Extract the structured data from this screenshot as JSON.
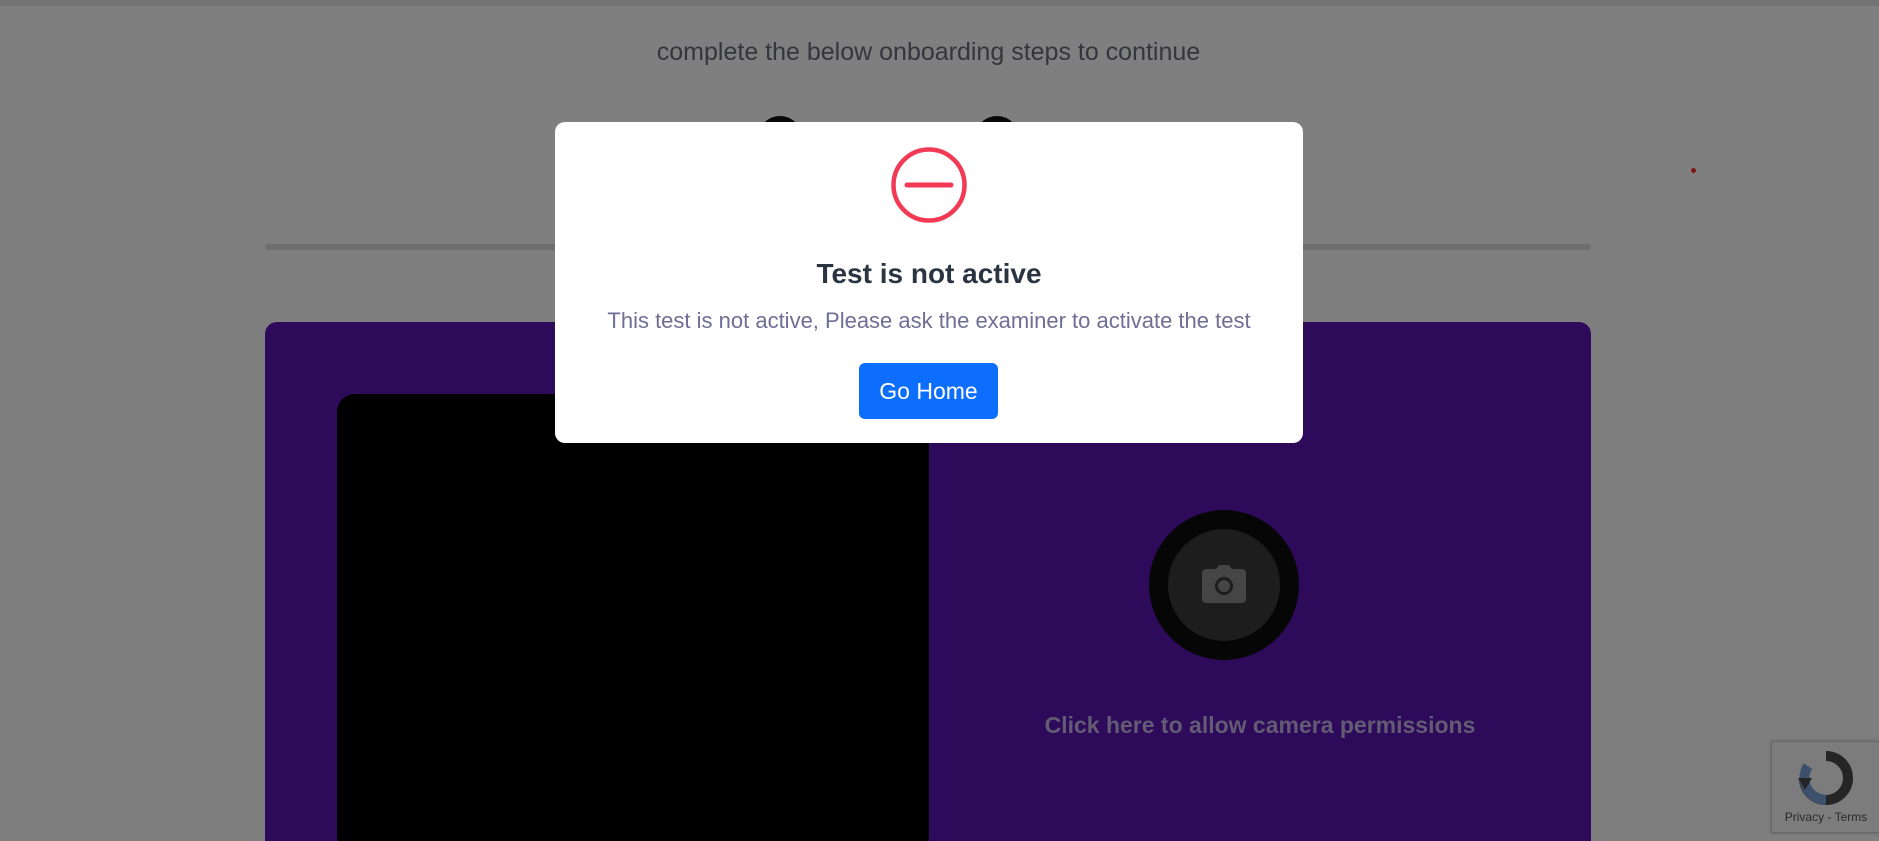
{
  "page": {
    "subtitle": "complete the below onboarding steps to continue"
  },
  "camera": {
    "icon": "camera-icon",
    "prompt": "Click here to allow camera permissions"
  },
  "modal": {
    "icon": "minus-circle-icon",
    "title": "Test is not active",
    "message": "This test is not active, Please ask the examiner to activate the test",
    "button_label": "Go Home"
  },
  "recaptcha": {
    "privacy": "Privacy",
    "separator": " - ",
    "terms": "Terms"
  },
  "colors": {
    "card_purple": "#5a14b4",
    "error_red": "#f23a55",
    "primary_blue": "#0d6efd"
  }
}
